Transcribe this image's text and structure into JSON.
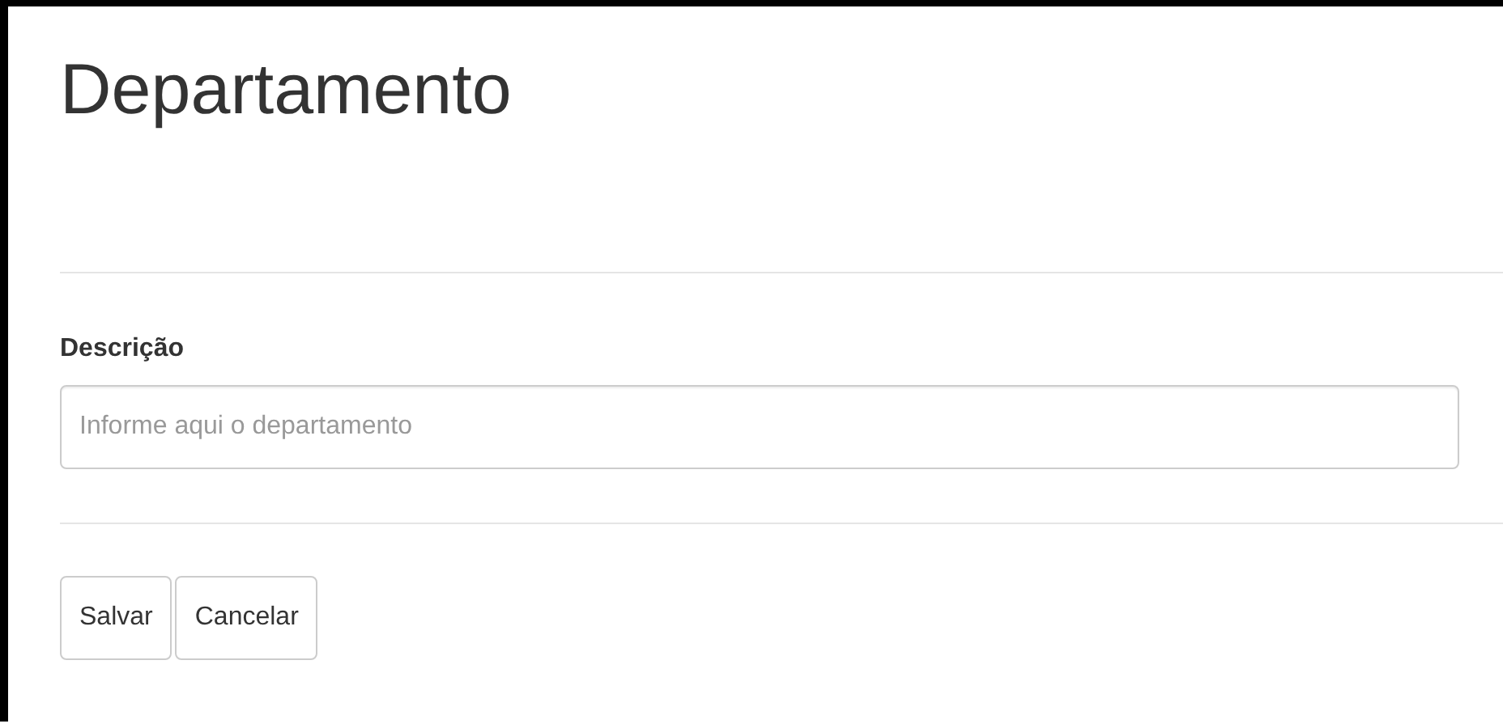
{
  "title": "Departamento",
  "form": {
    "label": "Descrição",
    "placeholder": "Informe aqui o departamento"
  },
  "buttons": [
    {
      "label": "Salvar"
    },
    {
      "label": "Cancelar"
    }
  ]
}
